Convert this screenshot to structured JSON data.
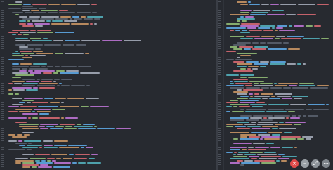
{
  "colors": {
    "background": "#272a30",
    "tag": "#e06c75",
    "attr": "#d19a66",
    "string": "#98c379",
    "keyword": "#c678dd",
    "comment": "#5c6370",
    "text": "#abb2bf",
    "blue": "#61afef",
    "cyan": "#56b6c2"
  },
  "window_controls": [
    {
      "name": "close",
      "icon": "close-icon",
      "glyph": "×"
    },
    {
      "name": "minimize",
      "icon": "minimize-icon",
      "glyph": "–"
    },
    {
      "name": "fullscreen",
      "icon": "fullscreen-icon",
      "glyph": "⤢"
    },
    {
      "name": "more",
      "icon": "more-icon",
      "glyph": "⋯"
    }
  ]
}
